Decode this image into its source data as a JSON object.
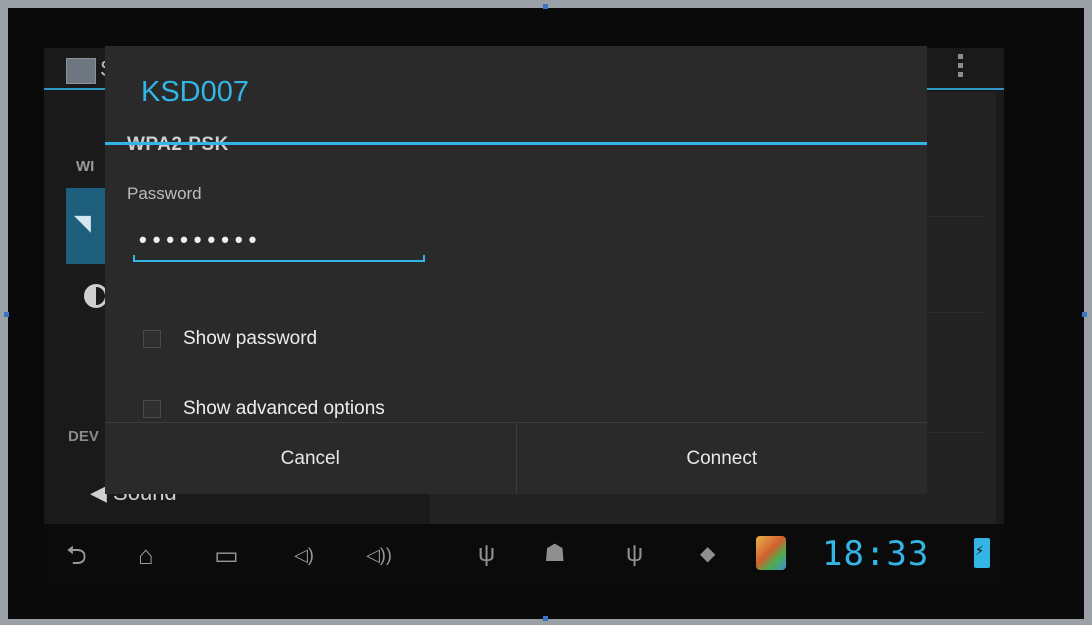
{
  "background": {
    "app_title": "S",
    "header_wireless": "WI",
    "header_device": "DEV",
    "sound_label": "Sound"
  },
  "dialog": {
    "title": "KSD007",
    "security": "WPA2 PSK",
    "password_label": "Password",
    "password_value": "•••••••••",
    "show_password_label": "Show password",
    "show_advanced_label": "Show advanced options",
    "cancel_label": "Cancel",
    "connect_label": "Connect"
  },
  "system_bar": {
    "clock": "18:33"
  },
  "colors": {
    "accent": "#33b5e5"
  },
  "icons": [
    "back-icon",
    "home-icon",
    "recent-apps-icon",
    "volume-down-icon",
    "volume-up-icon",
    "usb-icon",
    "android-debug-icon",
    "usb-icon",
    "wifi-icon",
    "app-notification-icon",
    "battery-charging-icon"
  ]
}
